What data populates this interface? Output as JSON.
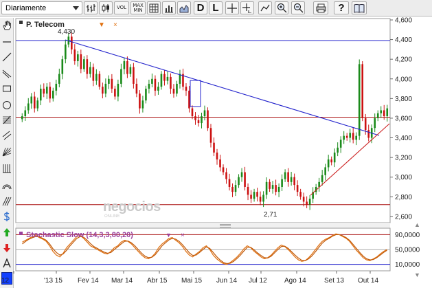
{
  "toolbar": {
    "period": "Diariamente",
    "vol_label": "VOL",
    "max_label": "MAX",
    "min_label": "MIN",
    "d_label": "D",
    "l_label": "L",
    "help_label": "?"
  },
  "main_chart": {
    "instrument": "P. Telecom",
    "high_label": "4,430",
    "low_label": "2,71",
    "watermark": "negocios",
    "watermark_sub": "ONLINE",
    "y_ticks": [
      "4,600",
      "4,400",
      "4,200",
      "4,000",
      "3,800",
      "3,600",
      "3,400",
      "3,200",
      "3,000",
      "2,800",
      "2,600"
    ],
    "colors": {
      "up": "#1a8a1a",
      "down": "#cc1111",
      "trendline": "#2222cc",
      "support": "#aa1111",
      "uptrend": "#cc2222",
      "stoch": "#e07010"
    }
  },
  "stochastic": {
    "label": "Stochastic Slow (14,3,3,80,20)",
    "y_ticks": [
      "90,0000",
      "50,0000",
      "10,0000"
    ]
  },
  "x_axis": {
    "labels": [
      "12",
      "'13 15",
      "Fev 14",
      "Mar 14",
      "Abr 15",
      "Mai 15",
      "Jun 14",
      "Jul 12",
      "Ago 14",
      "Set 13",
      "Out 14"
    ]
  },
  "chart_data": {
    "type": "candlestick",
    "title": "P. Telecom",
    "y_range": [
      2.55,
      4.6
    ],
    "annotations": [
      {
        "label": "4,430",
        "value": 4.43
      },
      {
        "label": "2,71",
        "value": 2.71
      }
    ],
    "horizontal_lines": [
      4.39,
      3.61,
      2.72
    ],
    "series": [
      {
        "values": [
          3.62,
          3.68,
          3.75,
          3.82,
          3.7,
          3.78,
          3.9,
          3.85,
          3.92,
          3.8,
          3.88,
          3.95,
          4.05,
          4.2,
          4.35,
          4.43,
          4.3,
          4.18,
          4.25,
          4.1,
          4.2,
          4.05,
          4.12,
          3.98,
          4.05,
          3.92,
          3.85,
          3.95,
          4.0,
          3.9,
          3.82,
          3.95,
          4.1,
          4.18,
          4.05,
          4.12,
          3.95,
          3.85,
          3.7,
          3.78,
          3.9,
          3.95,
          4.0,
          3.88,
          3.92,
          4.05,
          3.98,
          4.02,
          3.9,
          3.85,
          3.95,
          4.05,
          3.92,
          3.88,
          3.7,
          3.62,
          3.58,
          3.55,
          3.62,
          3.68,
          3.5,
          3.35,
          3.25,
          3.18,
          3.1,
          3.05,
          2.98,
          2.9,
          2.85,
          2.92,
          3.0,
          3.05,
          2.9,
          2.82,
          2.78,
          2.85,
          2.8,
          2.75,
          2.82,
          2.95,
          2.88,
          2.92,
          2.85,
          2.9,
          2.98,
          3.05,
          2.95,
          3.0,
          2.92,
          2.85,
          2.8,
          2.75,
          2.72,
          2.78,
          2.85,
          2.9,
          2.95,
          3.02,
          3.1,
          3.18,
          3.15,
          3.25,
          3.3,
          3.38,
          3.42,
          3.4,
          3.45,
          3.38,
          3.42,
          4.15,
          3.6,
          3.48,
          3.4,
          3.5,
          3.6,
          3.65,
          3.68,
          3.62,
          3.7
        ]
      }
    ],
    "stochastic_series": [
      {
        "values": [
          70,
          75,
          80,
          85,
          88,
          82,
          78,
          72,
          60,
          45,
          35,
          30,
          40,
          55,
          65,
          75,
          85,
          88,
          80,
          70,
          60,
          55,
          50,
          45,
          40,
          38,
          45,
          55,
          60,
          70,
          75,
          72,
          65,
          55,
          45,
          35,
          28,
          25,
          30,
          40,
          55,
          65,
          72,
          80,
          82,
          75,
          68,
          58,
          45,
          35,
          30,
          38,
          45,
          55,
          60,
          50,
          35,
          25,
          18,
          12,
          10,
          15,
          22,
          30,
          40,
          52,
          60,
          55,
          45,
          38,
          30,
          25,
          28,
          35,
          45,
          55,
          62,
          58,
          50,
          40,
          30,
          22,
          18,
          20,
          28,
          38,
          50,
          62,
          72,
          78,
          82,
          88,
          92,
          90,
          85,
          80,
          72,
          60,
          48,
          38,
          28,
          22,
          20,
          25,
          30,
          38,
          45,
          50
        ]
      },
      {
        "values": [
          65,
          72,
          78,
          82,
          85,
          84,
          80,
          75,
          65,
          52,
          42,
          35,
          38,
          48,
          60,
          70,
          80,
          85,
          83,
          75,
          66,
          58,
          53,
          48,
          43,
          40,
          42,
          50,
          57,
          65,
          72,
          73,
          68,
          60,
          50,
          40,
          32,
          28,
          29,
          36,
          48,
          60,
          68,
          76,
          80,
          78,
          72,
          63,
          52,
          41,
          34,
          35,
          42,
          50,
          57,
          53,
          42,
          31,
          22,
          15,
          12,
          13,
          18,
          26,
          35,
          46,
          56,
          56,
          49,
          41,
          34,
          28,
          27,
          32,
          41,
          50,
          58,
          59,
          53,
          44,
          35,
          27,
          21,
          20,
          25,
          33,
          44,
          56,
          67,
          75,
          80,
          86,
          90,
          90,
          87,
          82,
          75,
          64,
          53,
          42,
          32,
          25,
          22,
          23,
          28,
          35,
          42,
          48
        ]
      }
    ],
    "stochastic_ticks": [
      90,
      50,
      10
    ]
  }
}
